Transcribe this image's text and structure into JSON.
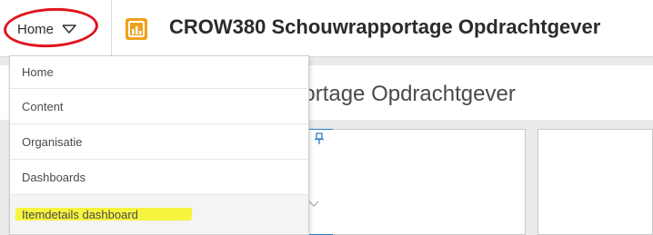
{
  "header": {
    "home_label": "Home",
    "app_title": "CROW380 Schouwrapportage Opdrachtgever",
    "icons": {
      "home_chevron": "chevron-down-icon",
      "app_logo": "dashboard-app-icon"
    },
    "colors": {
      "logo_orange": "#f0a11b",
      "annotation_circle": "#e0141e"
    }
  },
  "dropdown": {
    "items": [
      {
        "label": "Home"
      },
      {
        "label": "Content"
      },
      {
        "label": "Organisatie"
      },
      {
        "label": "Dashboards"
      },
      {
        "label": "Itemdetails dashboard"
      }
    ],
    "highlight_color": "#f7f31e"
  },
  "dashboard": {
    "title_fragment": "portage Opdrachtgever",
    "icons": {
      "pin": "pin-icon"
    }
  }
}
